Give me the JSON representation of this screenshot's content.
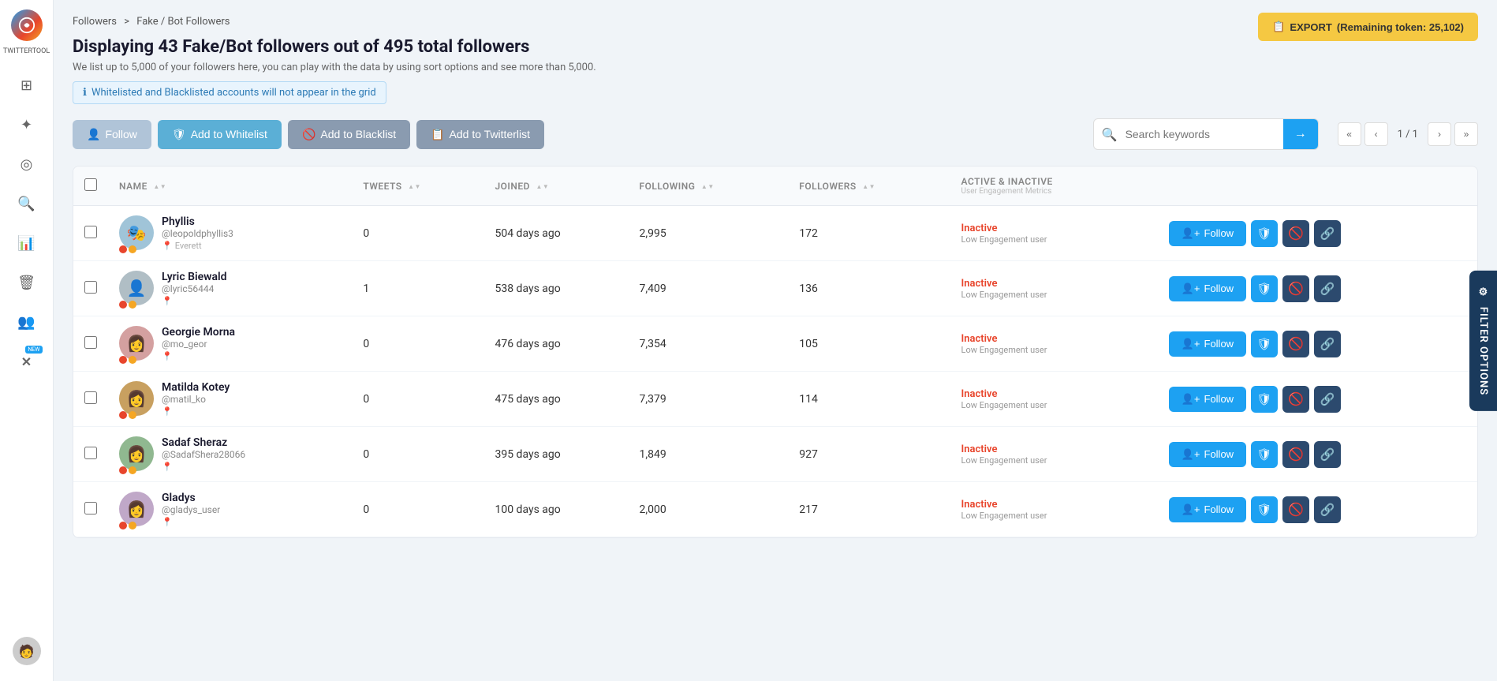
{
  "app": {
    "name": "TWITTERTOOL"
  },
  "export_button": {
    "label": "EXPORT",
    "token_text": "(Remaining token: 25,102)"
  },
  "breadcrumb": {
    "parent": "Followers",
    "separator": ">",
    "current": "Fake / Bot Followers"
  },
  "page": {
    "title": "Displaying 43 Fake/Bot followers out of 495 total followers",
    "subtitle": "We list up to 5,000 of your followers here, you can play with the data by using sort options and see more than 5,000.",
    "info_banner": "Whitelisted and Blacklisted accounts will not appear in the grid"
  },
  "toolbar": {
    "follow_label": "Follow",
    "whitelist_label": "Add to Whitelist",
    "blacklist_label": "Add to Blacklist",
    "twitterlist_label": "Add to Twitterlist",
    "search_placeholder": "Search keywords"
  },
  "pagination": {
    "current": "1",
    "total": "1",
    "display": "1 / 1"
  },
  "filter_sidebar": {
    "label": "FILTER OPTIONS"
  },
  "table": {
    "headers": {
      "name": "NAME",
      "tweets": "TWEETS",
      "joined": "JOINED",
      "following": "FOLLOWING",
      "followers": "FOLLOWERS",
      "active_inactive": "ACTIVE & INACTIVE",
      "engagement_sub": "User Engagement Metrics"
    },
    "rows": [
      {
        "id": 1,
        "name": "Phyllis",
        "handle": "@leopoldphyllis3",
        "location": "Everett",
        "tweets": "0",
        "joined": "504 days ago",
        "following": "2,995",
        "followers": "172",
        "status": "Inactive",
        "engagement": "Low Engagement user",
        "avatar_emoji": "🎭",
        "avatar_bg": "#a0c4d8"
      },
      {
        "id": 2,
        "name": "Lyric Biewald",
        "handle": "@lyric56444",
        "location": "",
        "tweets": "1",
        "joined": "538 days ago",
        "following": "7,409",
        "followers": "136",
        "status": "Inactive",
        "engagement": "Low Engagement user",
        "avatar_emoji": "👤",
        "avatar_bg": "#b0bec5"
      },
      {
        "id": 3,
        "name": "Georgie Morna",
        "handle": "@mo_geor",
        "location": "",
        "tweets": "0",
        "joined": "476 days ago",
        "following": "7,354",
        "followers": "105",
        "status": "Inactive",
        "engagement": "Low Engagement user",
        "avatar_emoji": "👩",
        "avatar_bg": "#d4a0a0"
      },
      {
        "id": 4,
        "name": "Matilda Kotey",
        "handle": "@matil_ko",
        "location": "",
        "tweets": "0",
        "joined": "475 days ago",
        "following": "7,379",
        "followers": "114",
        "status": "Inactive",
        "engagement": "Low Engagement user",
        "avatar_emoji": "👩",
        "avatar_bg": "#c8a060"
      },
      {
        "id": 5,
        "name": "Sadaf Sheraz",
        "handle": "@SadafShera28066",
        "location": "",
        "tweets": "0",
        "joined": "395 days ago",
        "following": "1,849",
        "followers": "927",
        "status": "Inactive",
        "engagement": "Low Engagement user",
        "avatar_emoji": "👩",
        "avatar_bg": "#90b890"
      },
      {
        "id": 6,
        "name": "Gladys",
        "handle": "@gladys_user",
        "location": "",
        "tweets": "0",
        "joined": "100 days ago",
        "following": "2,000",
        "followers": "217",
        "status": "Inactive",
        "engagement": "Low Engagement user",
        "avatar_emoji": "👩",
        "avatar_bg": "#c0a8c8"
      }
    ],
    "action_buttons": {
      "follow": "Follow",
      "shield_icon": "shield-icon",
      "block_icon": "block-icon",
      "link_icon": "link-icon"
    }
  },
  "sidebar_nav": [
    {
      "icon": "⊞",
      "name": "dashboard-icon"
    },
    {
      "icon": "✦",
      "name": "analytics-icon"
    },
    {
      "icon": "◎",
      "name": "target-icon"
    },
    {
      "icon": "🔍",
      "name": "search-icon"
    },
    {
      "icon": "📊",
      "name": "stats-icon"
    },
    {
      "icon": "🗑",
      "name": "trash-icon"
    },
    {
      "icon": "👥",
      "name": "users-icon"
    },
    {
      "icon": "✕",
      "name": "twitter-x-icon",
      "new": true
    }
  ]
}
